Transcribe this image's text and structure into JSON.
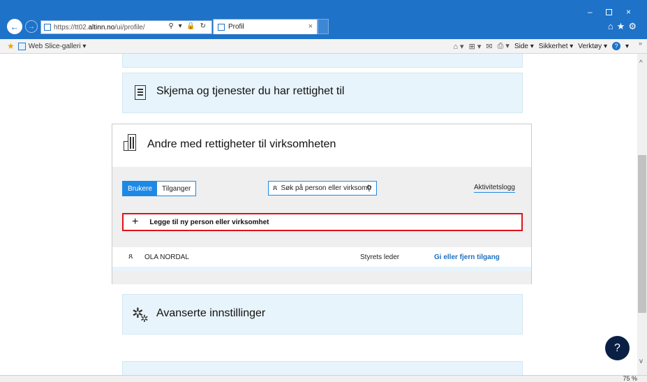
{
  "browser": {
    "url_prefix": "https://tt02.",
    "url_domain": "altinn.no",
    "url_path": "/ui/profile/",
    "addr_tools": "⚲ ▾ 🔒 ↻",
    "tab_title": "Profil",
    "tab_close": "×",
    "back_icon": "←",
    "forward_icon": "→",
    "window_min": "–",
    "window_close": "×",
    "right_icons": "⌂★⚙",
    "zoom_level": "75 %"
  },
  "cmdbar": {
    "favorites_icon": "★",
    "web_slice": "Web Slice-galleri ▾",
    "home_icon": "⌂ ▾",
    "rss_icon": "⊞ ▾",
    "mail_icon": "✉",
    "print_icon": "⎙ ▾",
    "side": "Side ▾",
    "sikkerhet": "Sikkerhet ▾",
    "verktoy": "Verktøy ▾",
    "help": "?",
    "help_chevron": "▾",
    "more": "»"
  },
  "cards": {
    "skjema_title": "Skjema og tjenester du har rettighet til",
    "andre_title": "Andre med rettigheter til virksomheten",
    "avansert_title": "Avanserte innstillinger"
  },
  "users_panel": {
    "tab_brukere": "Brukere",
    "tab_tilganger": "Tilganger",
    "person_icon": "ጸ",
    "search_placeholder": "Søk på person eller virksomh",
    "search_icon": "⚲",
    "activity_log": "Aktivitetslogg",
    "add_icon": "+",
    "add_label": "Legge til ny person eller virksomhet",
    "rows": [
      {
        "name": "OLA NORDAL",
        "role": "Styrets leder",
        "action": "Gi eller fjern tilgang"
      }
    ]
  },
  "icons": {
    "gear_large": "✲",
    "gear_small": "✲"
  },
  "help_button": "?",
  "scroll": {
    "up": "^",
    "down": "v"
  },
  "colors": {
    "titlebar": "#1e72c8",
    "accent": "#1e88e5",
    "card_bg": "#e8f4fb",
    "highlight_border": "#e0121c",
    "fab": "#0a1f44"
  }
}
